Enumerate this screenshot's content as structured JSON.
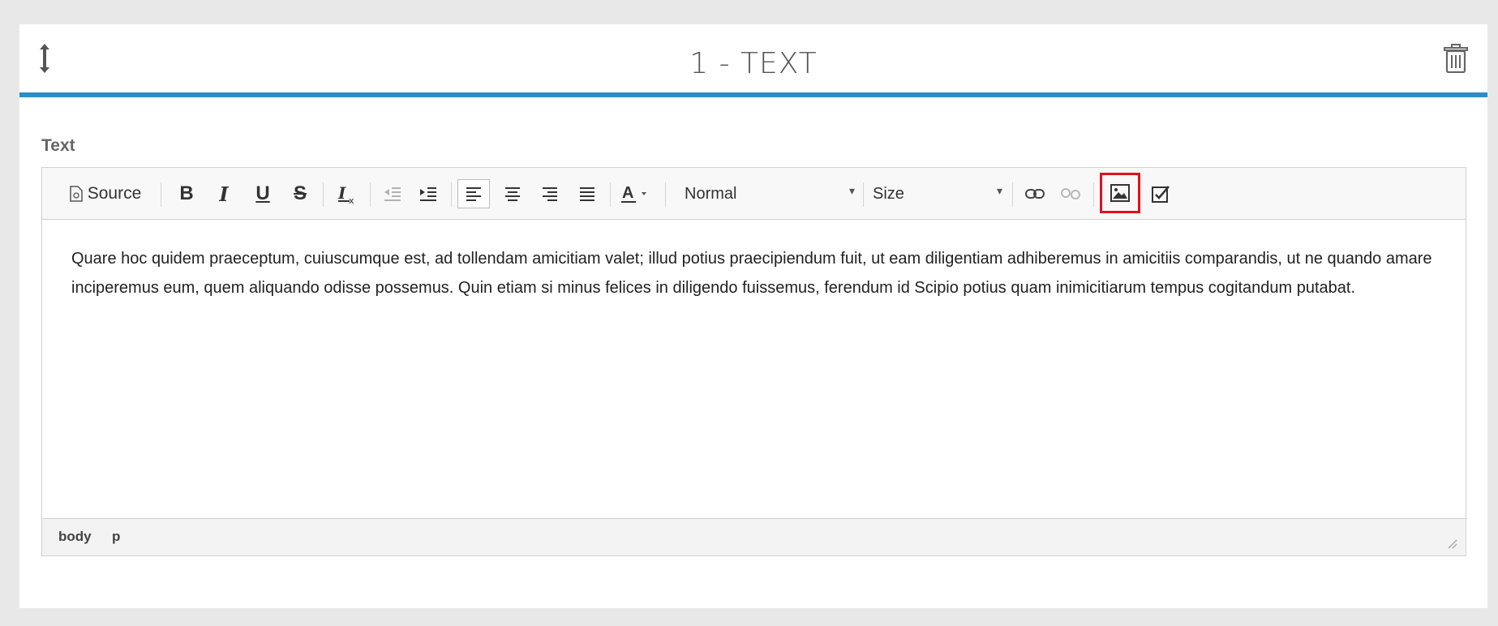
{
  "panel": {
    "title": "1 - TEXT"
  },
  "field": {
    "label": "Text"
  },
  "toolbar": {
    "source_label": "Source",
    "format_value": "Normal",
    "size_value": "Size",
    "highlight_color": "#e0121b",
    "icons": [
      "source-icon",
      "bold",
      "italic",
      "underline",
      "strikethrough",
      "remove-format",
      "outdent",
      "indent",
      "align-left",
      "align-center",
      "align-right",
      "justify",
      "text-color",
      "link",
      "unlink",
      "image",
      "checkbox"
    ]
  },
  "content": {
    "paragraph": "Quare hoc quidem praeceptum, cuiuscumque est, ad tollendam amicitiam valet; illud potius praecipiendum fuit, ut eam diligentiam adhiberemus in amicitiis comparandis, ut ne quando amare inciperemus eum, quem aliquando odisse possemus. Quin etiam si minus felices in diligendo fuissemus, ferendum id Scipio potius quam inimicitiarum tempus cogitandum putabat."
  },
  "statusbar": {
    "path": [
      "body",
      "p"
    ]
  },
  "colors": {
    "accent": "#2a8fc4",
    "background": "#e8e8e8"
  }
}
